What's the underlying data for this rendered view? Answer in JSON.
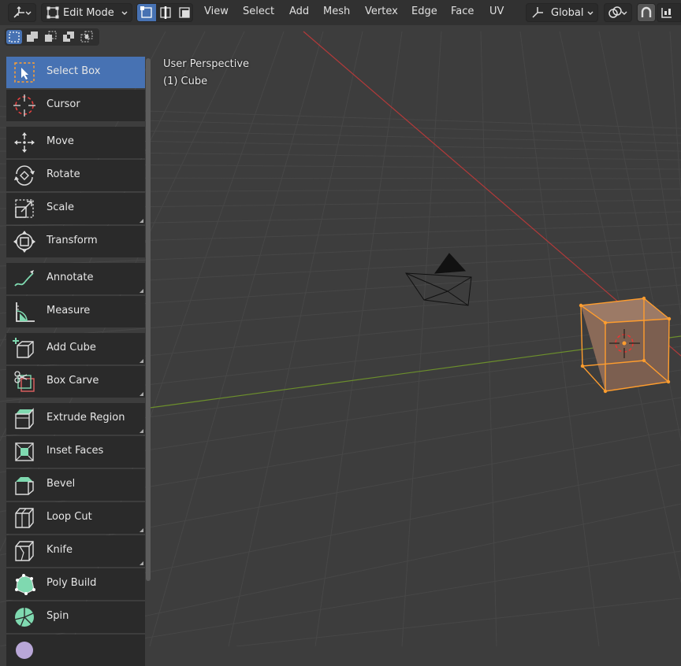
{
  "header": {
    "editor_type_icon": "axes-icon",
    "mode_label": "Edit Mode",
    "menus": [
      "View",
      "Select",
      "Add",
      "Mesh",
      "Vertex",
      "Edge",
      "Face",
      "UV"
    ],
    "orientation_label": "Global",
    "select_modes": [
      "vertex-select-icon",
      "edge-select-icon",
      "face-select-icon"
    ],
    "snap_icon": "magnet-icon",
    "transform_pivot_icon": "link-icon",
    "proportional_icon": "proportional-icon"
  },
  "selection_tool_modes": [
    "new-selection-icon",
    "extend-selection-icon",
    "subtract-selection-icon",
    "invert-selection-icon",
    "intersect-selection-icon"
  ],
  "overlay": {
    "view_name": "User Perspective",
    "object_name": "(1) Cube"
  },
  "tools": [
    {
      "label": "Select Box",
      "icon": "select-box-icon",
      "active": true
    },
    {
      "label": "Cursor",
      "icon": "cursor-icon"
    },
    {
      "label": "Move",
      "icon": "move-icon"
    },
    {
      "label": "Rotate",
      "icon": "rotate-icon"
    },
    {
      "label": "Scale",
      "icon": "scale-icon"
    },
    {
      "label": "Transform",
      "icon": "transform-icon"
    },
    {
      "label": "Annotate",
      "icon": "annotate-icon"
    },
    {
      "label": "Measure",
      "icon": "measure-icon"
    },
    {
      "label": "Add Cube",
      "icon": "add-cube-icon"
    },
    {
      "label": "Box Carve",
      "icon": "box-carve-icon"
    },
    {
      "label": "Extrude Region",
      "icon": "extrude-region-icon"
    },
    {
      "label": "Inset Faces",
      "icon": "inset-faces-icon"
    },
    {
      "label": "Bevel",
      "icon": "bevel-icon"
    },
    {
      "label": "Loop Cut",
      "icon": "loop-cut-icon"
    },
    {
      "label": "Knife",
      "icon": "knife-icon"
    },
    {
      "label": "Poly Build",
      "icon": "poly-build-icon"
    },
    {
      "label": "Spin",
      "icon": "spin-icon"
    }
  ],
  "colors": {
    "active_tool": "#4772b3",
    "selection": "#ffa033",
    "x_axis": "#d03a3a",
    "y_axis": "#7fa83a",
    "tool_icon_green": "#7fd9b0"
  }
}
